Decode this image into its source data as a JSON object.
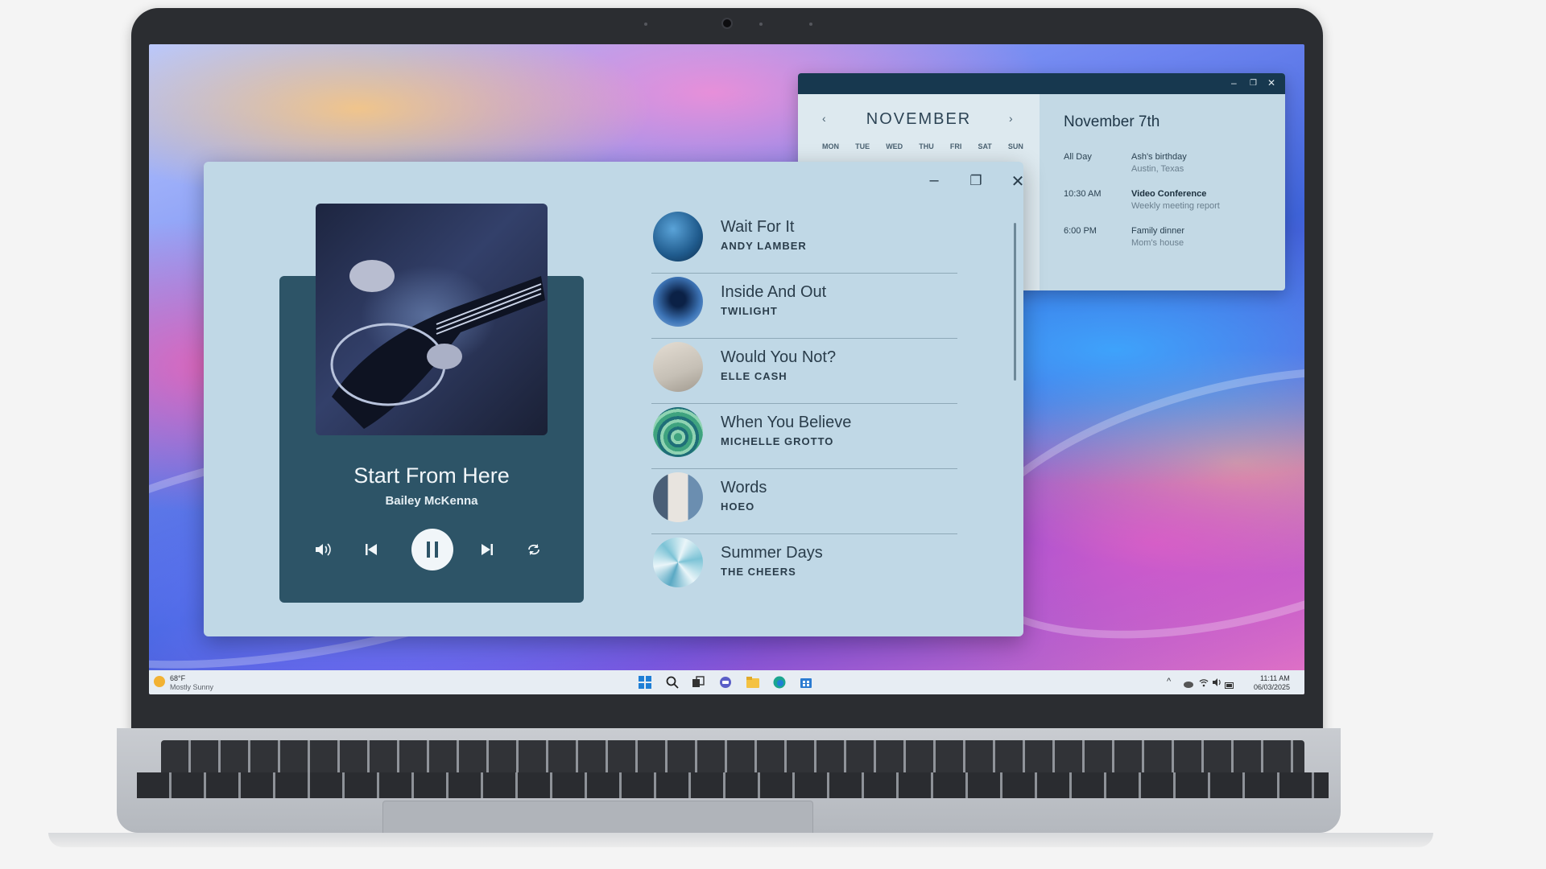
{
  "calendar": {
    "month": "NOVEMBER",
    "prev_icon": "chevron-left-icon",
    "next_icon": "chevron-right-icon",
    "weekdays": [
      "MON",
      "TUE",
      "WED",
      "THU",
      "FRI",
      "SAT",
      "SUN"
    ],
    "selected_date": "November 7th",
    "events": [
      {
        "time": "All Day",
        "title": "Ash's birthday",
        "subtitle": "Austin, Texas",
        "emphasis": false
      },
      {
        "time": "10:30 AM",
        "title": "Video Conference",
        "subtitle": "Weekly meeting report",
        "emphasis": true
      },
      {
        "time": "6:00 PM",
        "title": "Family dinner",
        "subtitle": "Mom's house",
        "emphasis": false
      }
    ]
  },
  "player": {
    "now_playing": {
      "title": "Start From Here",
      "artist": "Bailey McKenna"
    },
    "controls": [
      "volume-icon",
      "previous-icon",
      "pause-icon",
      "next-icon",
      "repeat-icon"
    ],
    "tracks": [
      {
        "title": "Wait For It",
        "artist": "ANDY LAMBER",
        "thumb_color": "#1f5a8c"
      },
      {
        "title": "Inside And Out",
        "artist": "TWILIGHT",
        "thumb_color": "#3c73b5"
      },
      {
        "title": "Would You Not?",
        "artist": "ELLE CASH",
        "thumb_color": "#c6c0b6"
      },
      {
        "title": "When You Believe",
        "artist": "MICHELLE GROTTO",
        "thumb_color": "#3fa37f"
      },
      {
        "title": "Words",
        "artist": "HOEO",
        "thumb_color": "#8fb4d4"
      },
      {
        "title": "Summer Days",
        "artist": "THE CHEERS",
        "thumb_color": "#7cc3d6"
      }
    ]
  },
  "taskbar": {
    "weather_temp": "68°F",
    "weather_desc": "Mostly Sunny",
    "time": "11:11 AM",
    "date": "06/03/2025"
  },
  "colors": {
    "player_card": "#2d5467",
    "window_bg": "#c0d8e6",
    "titlebar": "#17384f"
  }
}
